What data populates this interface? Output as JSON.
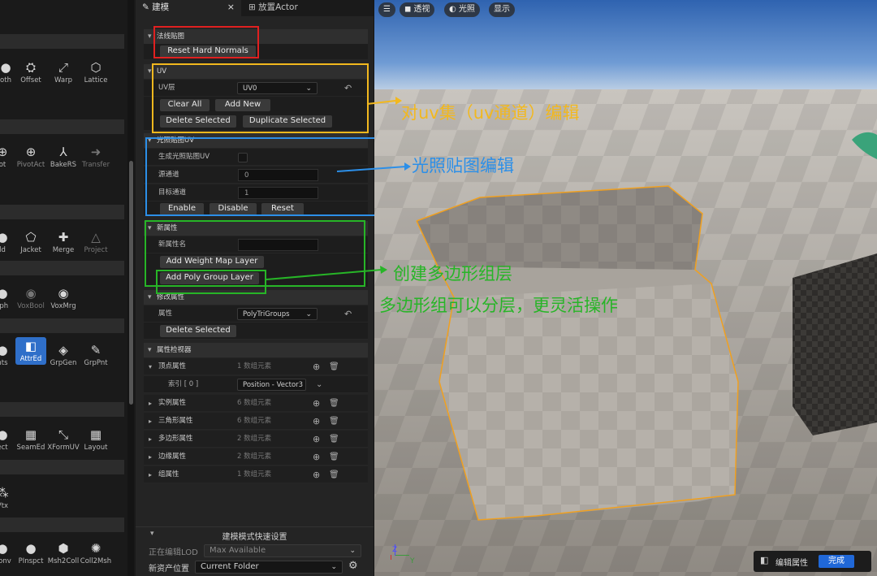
{
  "palette": {
    "row1": [
      "oth",
      "Offset",
      "Warp",
      "Lattice"
    ],
    "row2": [
      "ot",
      "PivotAct",
      "BakeRS",
      "Transfer"
    ],
    "row3": [
      "ld",
      "Jacket",
      "Merge",
      "Project"
    ],
    "row4": [
      "rph",
      "VoxBool",
      "VoxMrg"
    ],
    "row5": [
      "nts",
      "AttrEd",
      "GrpGen",
      "GrpPnt"
    ],
    "row6": [
      "ect",
      "SeamEd",
      "XFormUV",
      "Layout"
    ],
    "row7": [
      "Vtx"
    ],
    "row8": [
      "Conv",
      "PInspct",
      "Msh2Coll",
      "Coll2Msh"
    ]
  },
  "tabs": {
    "model": "建模",
    "place": "放置Actor"
  },
  "normals": {
    "title": "法线贴图",
    "reset_button": "Reset Hard Normals"
  },
  "uv": {
    "title": "UV",
    "layer_label": "UV层",
    "layer_value": "UV0",
    "clear_all": "Clear All",
    "add_new": "Add New",
    "delete_selected": "Delete Selected",
    "duplicate_selected": "Duplicate Selected"
  },
  "lightmap": {
    "title": "光照贴图UV",
    "generate_label": "生成光照贴图UV",
    "source_label": "源通道",
    "source_value": "0",
    "target_label": "目标通道",
    "target_value": "1",
    "enable": "Enable",
    "disable": "Disable",
    "reset": "Reset"
  },
  "new_attr": {
    "title": "新属性",
    "name_label": "新属性名",
    "add_weight": "Add Weight Map Layer",
    "add_poly": "Add Poly Group Layer"
  },
  "modify_attr": {
    "title": "修改属性",
    "attr_label": "属性",
    "attr_value": "PolyTriGroups",
    "delete_selected": "Delete Selected"
  },
  "inspector": {
    "title": "属性检视器",
    "rows": [
      {
        "name": "顶点属性",
        "count": "1 数组元素"
      },
      {
        "name": "实例属性",
        "count": "6 数组元素"
      },
      {
        "name": "三角形属性",
        "count": "6 数组元素"
      },
      {
        "name": "多边形属性",
        "count": "2 数组元素"
      },
      {
        "name": "边缘属性",
        "count": "2 数组元素"
      },
      {
        "name": "组属性",
        "count": "1 数组元素"
      }
    ],
    "index_label": "索引 [ 0 ]",
    "index_value": "Position  - Vector3"
  },
  "quick_settings": {
    "title": "建模模式快速设置",
    "lod_label": "正在编辑LOD",
    "lod_value": "Max Available",
    "asset_label": "新资产位置",
    "asset_value": "Current Folder"
  },
  "viewport": {
    "perspective": "透视",
    "lit": "光照",
    "show": "显示",
    "edit_attr": "编辑属性",
    "done": "完成",
    "axis_z": "Z",
    "axis_y": "Y"
  },
  "annotations": {
    "uv_note": "对uv集（uv通道）编辑",
    "lightmap_note": "光照贴图编辑",
    "poly_note1": "创建多边形组层",
    "poly_note2": "多边形组可以分层，更灵活操作"
  },
  "colors": {
    "red": "#e02020",
    "orange": "#f2b81e",
    "blue": "#2c8fe8",
    "green": "#27b527",
    "accent": "#2f6fc9"
  }
}
